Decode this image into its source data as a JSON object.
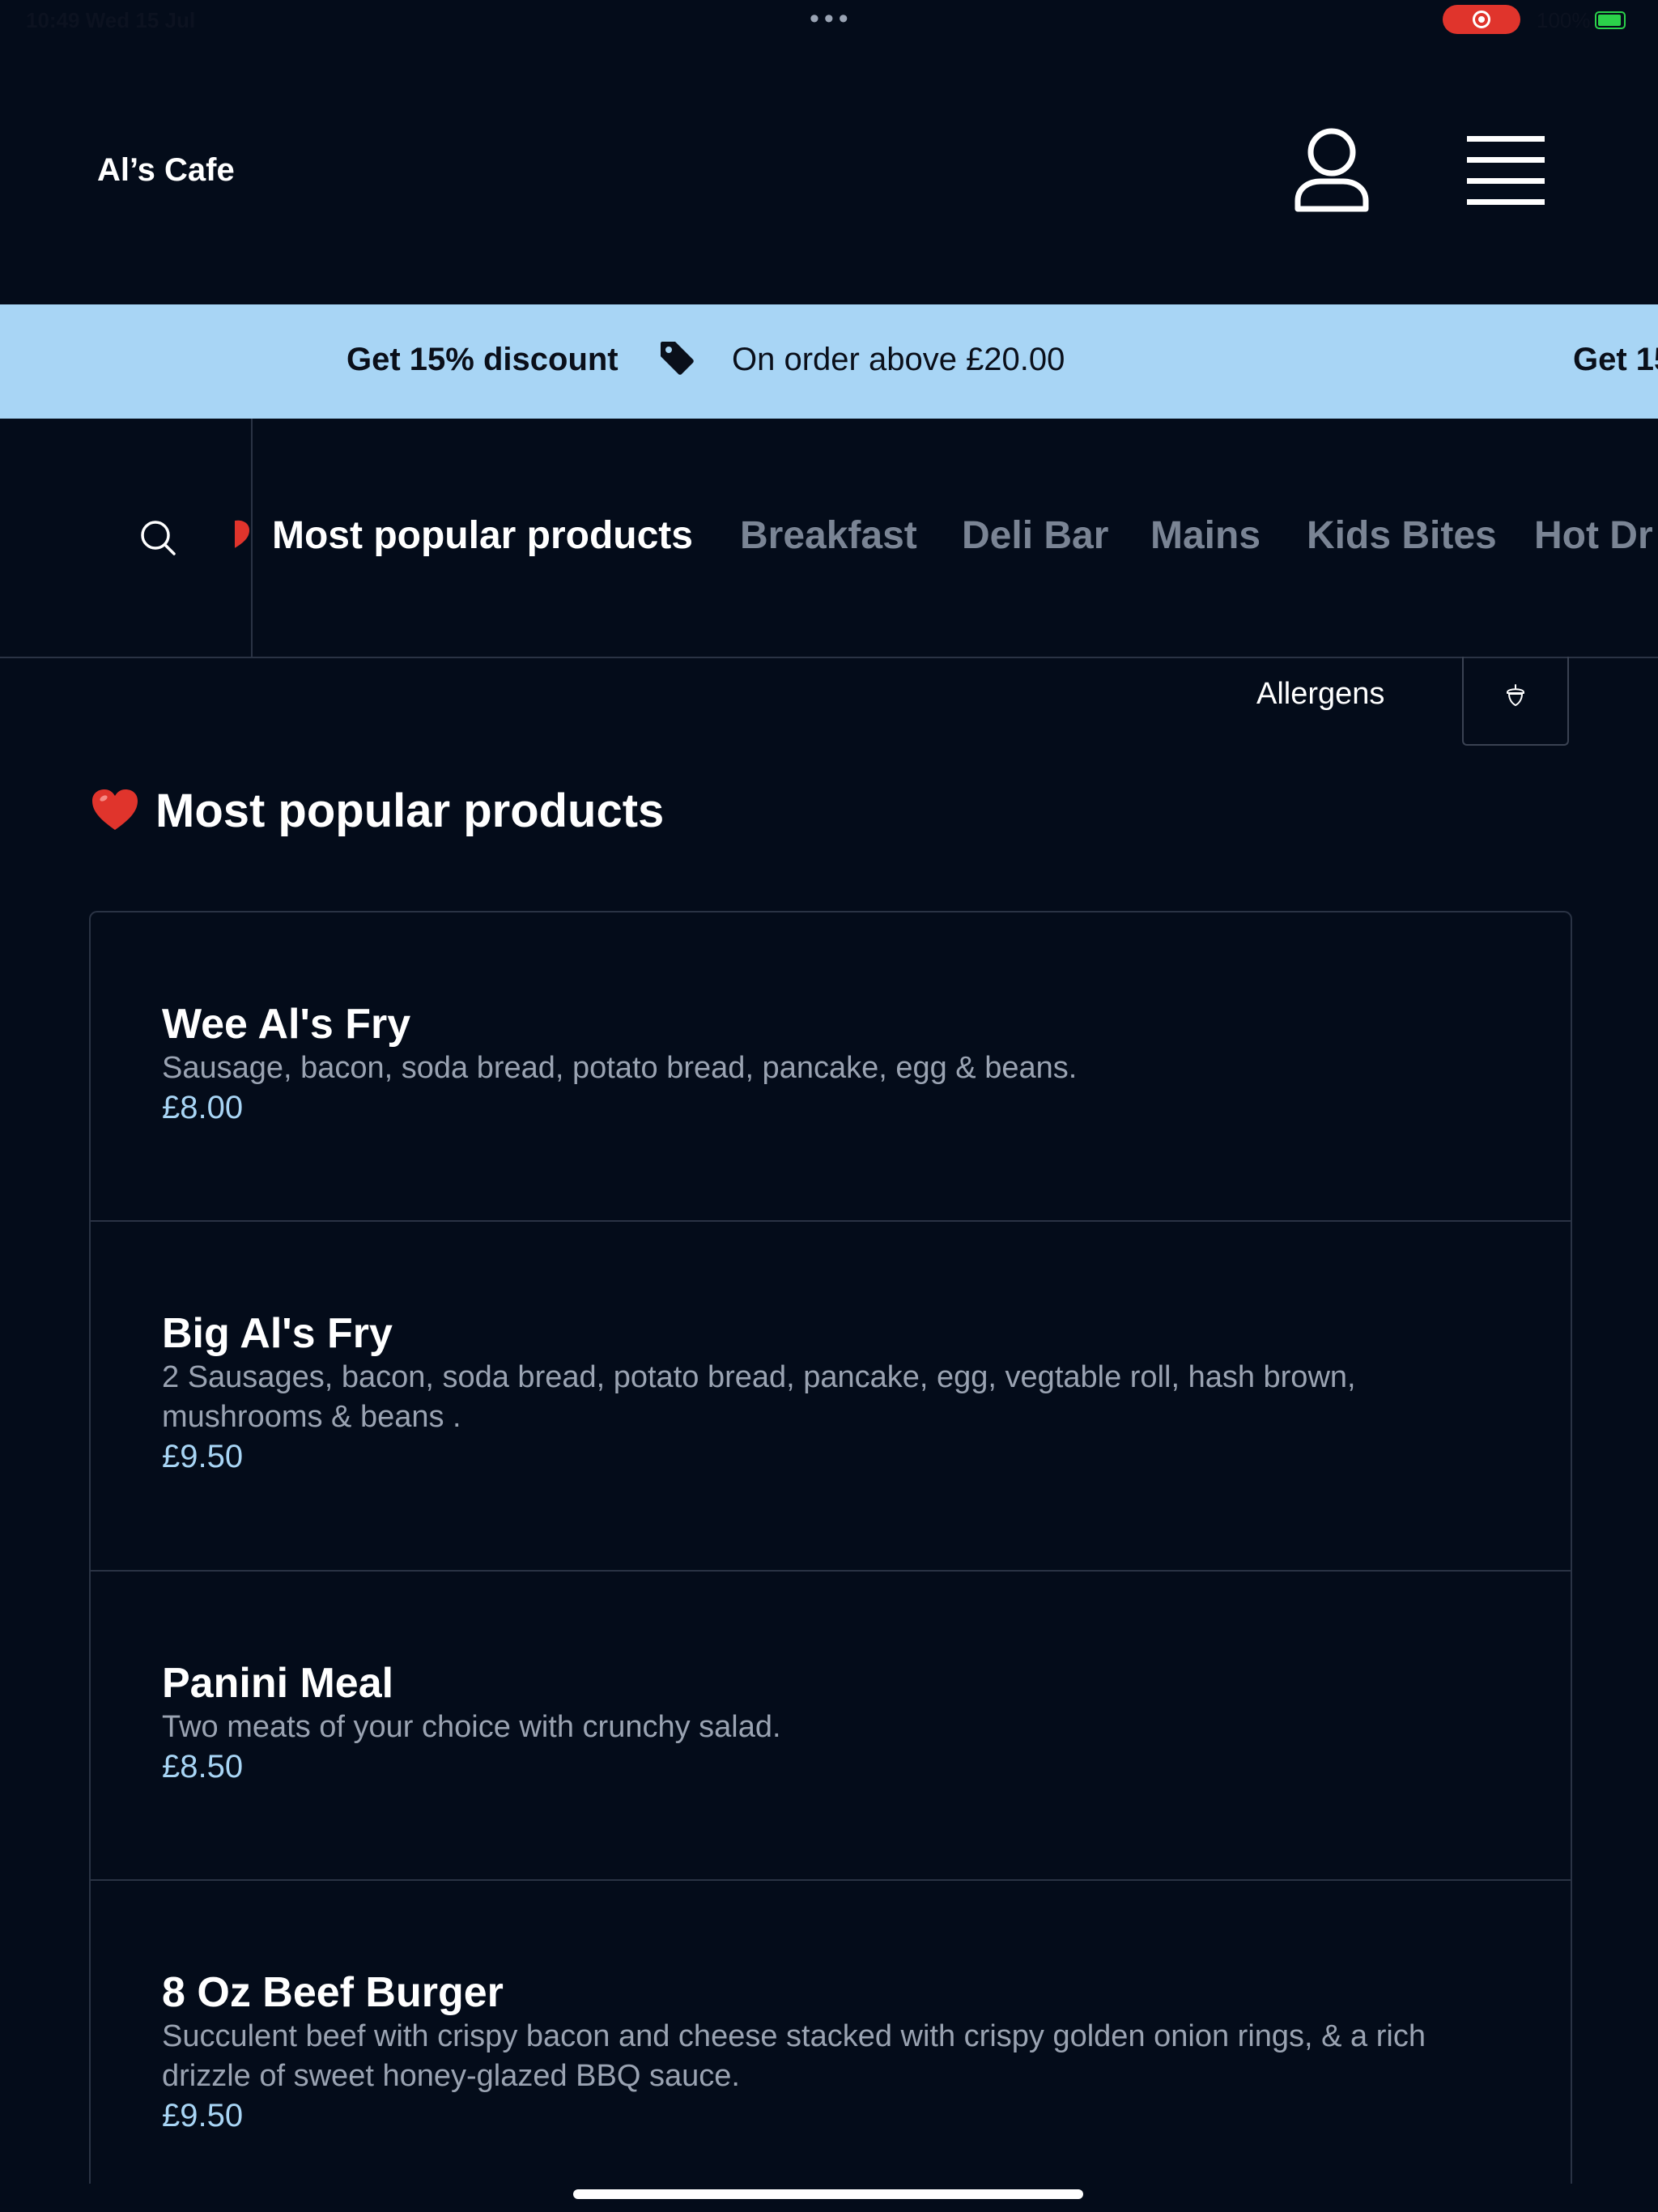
{
  "status_bar": {
    "time": "10:49  Wed 15 Jul",
    "battery": "100%"
  },
  "header": {
    "brand": "Al’s Cafe"
  },
  "promo": {
    "title": "Get 15% discount",
    "text": "On order above £20.00",
    "title_repeat": "Get 15"
  },
  "categories": [
    {
      "label": "Most popular products",
      "active": true
    },
    {
      "label": "Breakfast",
      "active": false
    },
    {
      "label": "Deli Bar",
      "active": false
    },
    {
      "label": "Mains",
      "active": false
    },
    {
      "label": "Kids Bites",
      "active": false
    },
    {
      "label": "Hot Dr",
      "active": false
    }
  ],
  "allergens": {
    "label": "Allergens"
  },
  "section": {
    "title": "Most popular products"
  },
  "products": [
    {
      "name": "Wee Al's Fry",
      "description": "Sausage, bacon, soda bread, potato bread, pancake, egg & beans.",
      "price": "£8.00"
    },
    {
      "name": "Big Al's Fry",
      "description": "2 Sausages, bacon, soda bread, potato bread, pancake, egg, vegtable roll, hash brown, mushrooms & beans .",
      "price": "£9.50"
    },
    {
      "name": "Panini Meal",
      "description": "Two meats of your choice with crunchy salad.",
      "price": "£8.50"
    },
    {
      "name": "8 Oz Beef Burger",
      "description": "Succulent beef with crispy bacon and cheese stacked with crispy golden onion rings, & a rich drizzle of sweet honey-glazed BBQ sauce.",
      "price": "£9.50"
    }
  ],
  "colors": {
    "background": "#040c1a",
    "promo_bg": "#a8d5f5",
    "price": "#a8d5f5",
    "inactive_category": "#7a8494",
    "record_indicator": "#e0342c"
  }
}
